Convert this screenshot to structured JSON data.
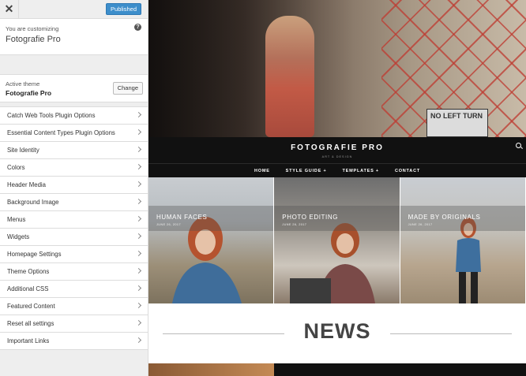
{
  "topbar": {
    "close_symbol": "✕",
    "publish_label": "Published"
  },
  "customizing": {
    "prefix": "You are customizing",
    "site_name": "Fotografie Pro",
    "help_symbol": "?"
  },
  "theme": {
    "label": "Active theme",
    "name": "Fotografie Pro",
    "change_label": "Change"
  },
  "menu": {
    "items": [
      "Catch Web Tools Plugin Options",
      "Essential Content Types Plugin Options",
      "Site Identity",
      "Colors",
      "Header Media",
      "Background Image",
      "Menus",
      "Widgets",
      "Homepage Settings",
      "Theme Options",
      "Additional CSS",
      "Featured Content",
      "Reset all settings",
      "Important Links"
    ]
  },
  "preview": {
    "hero_sign": "NO LEFT TURN",
    "site_title": "FOTOGRAFIE PRO",
    "site_tagline": "ART & DESIGN",
    "nav": [
      "HOME",
      "STYLE GUIDE +",
      "TEMPLATES +",
      "CONTACT"
    ],
    "featured": [
      {
        "title": "HUMAN FACES",
        "date": "JUNE 26, 2017"
      },
      {
        "title": "PHOTO EDITING",
        "date": "JUNE 26, 2017"
      },
      {
        "title": "MADE BY ORIGINALS",
        "date": "JUNE 26, 2017"
      }
    ],
    "news_title": "NEWS"
  },
  "colors": {
    "accent": "#3d8ecb",
    "nav_bg": "#111111",
    "sidebar_bg": "#eeeeee"
  }
}
